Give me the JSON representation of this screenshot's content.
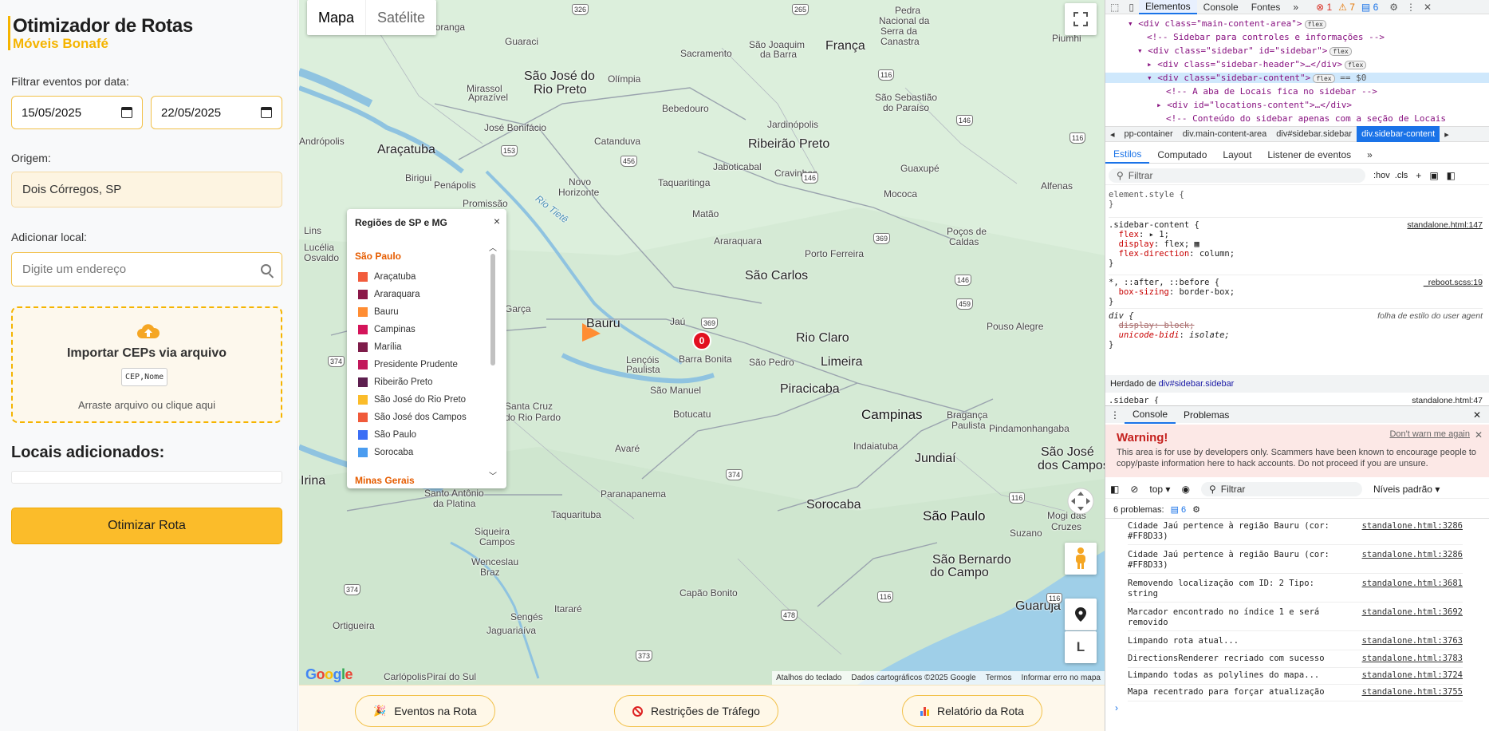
{
  "sidebar": {
    "title": "Otimizador de Rotas",
    "subtitle": "Móveis Bonafé",
    "filter_label": "Filtrar eventos por data:",
    "date_start": "15/05/2025",
    "date_end": "22/05/2025",
    "origin_label": "Origem:",
    "origin_value": "Dois Córregos, SP",
    "add_label": "Adicionar local:",
    "add_placeholder": "Digite um endereço",
    "import_title": "Importar CEPs via arquivo",
    "import_chip_a": "CEP",
    "import_chip_sep": ",",
    "import_chip_b": "Nome",
    "import_hint": "Arraste arquivo ou clique aqui",
    "locais_title": "Locais adicionados:",
    "optimize_button": "Otimizar Rota",
    "accent_color": "#fbbc2a"
  },
  "map": {
    "type_map": "Mapa",
    "type_sat": "Satélite",
    "marker_label": "0",
    "google": "Google",
    "attribution": [
      "Atalhos do teclado",
      "Dados cartográficos ©2025 Google",
      "Termos",
      "Informar erro no mapa"
    ],
    "zoom_label": "L",
    "cities": [
      {
        "n": "Votuporanga"
      },
      {
        "n": "Guaraci"
      },
      {
        "n": "França"
      },
      {
        "n": "São José do"
      },
      {
        "n": "Rio Preto"
      },
      {
        "n": "Olímpia"
      },
      {
        "n": "Mirassol"
      },
      {
        "n": "Aprazível"
      },
      {
        "n": "Bebedouro"
      },
      {
        "n": "José Bonifácio"
      },
      {
        "n": "Jardinópolis"
      },
      {
        "n": "Araçatuba"
      },
      {
        "n": "Catanduva"
      },
      {
        "n": "Ribeirão Preto"
      },
      {
        "n": "Birigui"
      },
      {
        "n": "Penápolis"
      },
      {
        "n": "Novo"
      },
      {
        "n": "Horizonte"
      },
      {
        "n": "Taquaritinga"
      },
      {
        "n": "Jaboticabal"
      },
      {
        "n": "Cravinhos"
      },
      {
        "n": "Guaxupé"
      },
      {
        "n": "Alfenas"
      },
      {
        "n": "Promissão"
      },
      {
        "n": "Matão"
      },
      {
        "n": "Mococa"
      },
      {
        "n": "Lins"
      },
      {
        "n": "Lucélia"
      },
      {
        "n": "Osvaldo"
      },
      {
        "n": "Araraquara"
      },
      {
        "n": "Porto Ferreira"
      },
      {
        "n": "Poços de"
      },
      {
        "n": "Caldas"
      },
      {
        "n": "São Carlos"
      },
      {
        "n": "Bauru"
      },
      {
        "n": "Jaú"
      },
      {
        "n": "Rio Claro"
      },
      {
        "n": "Barra Bonita"
      },
      {
        "n": "São Pedro"
      },
      {
        "n": "Limeira"
      },
      {
        "n": "Lençóis"
      },
      {
        "n": "Paulista"
      },
      {
        "n": "Pouso Alegre"
      },
      {
        "n": "São Manuel"
      },
      {
        "n": "Piracicaba"
      },
      {
        "n": "Botucatu"
      },
      {
        "n": "Campinas"
      },
      {
        "n": "Bragança"
      },
      {
        "n": "Paulista"
      },
      {
        "n": "Indaiatuba"
      },
      {
        "n": "Jundiaí"
      },
      {
        "n": "Pindamonhangaba"
      },
      {
        "n": "São José"
      },
      {
        "n": "dos Campos"
      },
      {
        "n": "Avaré"
      },
      {
        "n": "Santa Cruz"
      },
      {
        "n": "do Rio Pardo"
      },
      {
        "n": "Sorocaba"
      },
      {
        "n": "São Paulo"
      },
      {
        "n": "Mogi das"
      },
      {
        "n": "Cruzes"
      },
      {
        "n": "Suzano"
      },
      {
        "n": "São Bernardo"
      },
      {
        "n": "do Campo"
      },
      {
        "n": "Guarujá"
      },
      {
        "n": "Taquarituba"
      },
      {
        "n": "Paranapanema"
      },
      {
        "n": "Santo Antônio"
      },
      {
        "n": "da Platina"
      },
      {
        "n": "Siqueira"
      },
      {
        "n": "Campos"
      },
      {
        "n": "Wenceslau"
      },
      {
        "n": "Braz"
      },
      {
        "n": "Itararé"
      },
      {
        "n": "Capão Bonito"
      },
      {
        "n": "Jaguariaíva"
      },
      {
        "n": "Sengés"
      },
      {
        "n": "Ortigueira"
      },
      {
        "n": "Piraí do Sul"
      },
      {
        "n": "Garça"
      },
      {
        "n": "Irina"
      },
      {
        "n": "Pedra"
      },
      {
        "n": "Nacional da"
      },
      {
        "n": "Serra da"
      },
      {
        "n": "Canastra"
      },
      {
        "n": "Piumhi"
      },
      {
        "n": "São Joaquim"
      },
      {
        "n": "da Barra"
      },
      {
        "n": "Sacramento"
      },
      {
        "n": "São Sebastião"
      },
      {
        "n": "do Paraíso"
      },
      {
        "n": "Andrópolis"
      },
      {
        "n": "Rio Tietê"
      },
      {
        "n": "Carlópolis"
      }
    ],
    "shields": [
      "153",
      "153",
      "456",
      "326",
      "265",
      "369",
      "369",
      "374",
      "374",
      "374",
      "116",
      "116",
      "116",
      "459",
      "146",
      "146",
      "116",
      "146",
      "478",
      "373",
      "116"
    ]
  },
  "legend": {
    "title": "Regiões de SP e MG",
    "close": "×",
    "region1": "São Paulo",
    "region2": "Minas Gerais",
    "items": [
      {
        "label": "Araçatuba",
        "color": "#f25c3c"
      },
      {
        "label": "Araraquara",
        "color": "#8b1848"
      },
      {
        "label": "Bauru",
        "color": "#ff8d33"
      },
      {
        "label": "Campinas",
        "color": "#d4145a"
      },
      {
        "label": "Marília",
        "color": "#7e1c4a"
      },
      {
        "label": "Presidente Prudente",
        "color": "#c2185b"
      },
      {
        "label": "Ribeirão Preto",
        "color": "#5d1f4f"
      },
      {
        "label": "São José do Rio Preto",
        "color": "#fbbc2a"
      },
      {
        "label": "São José dos Campos",
        "color": "#f05a3a"
      },
      {
        "label": "São Paulo",
        "color": "#3b6ef5"
      },
      {
        "label": "Sorocaba",
        "color": "#4a9cf0"
      }
    ]
  },
  "bottom": {
    "events": "Eventos na Rota",
    "restrictions": "Restrições de Tráfego",
    "report": "Relatório da Rota"
  },
  "devtools": {
    "tabs": [
      "Elementos",
      "Console",
      "Fontes",
      "»"
    ],
    "err_count": "1",
    "warn_count": "7",
    "msg_count": "6",
    "dom": [
      {
        "t": "<div class=\"main-content-area\">",
        "b": "flex"
      },
      {
        "t": "<!-- Sidebar para controles e informações -->",
        "b": ""
      },
      {
        "t": "<div class=\"sidebar\" id=\"sidebar\">",
        "b": "flex"
      },
      {
        "t": "<div class=\"sidebar-header\">…</div>",
        "b": "flex"
      },
      {
        "t": "<div class=\"sidebar-content\">",
        "b": "flex",
        "s": "== $0"
      },
      {
        "t": "<!-- A aba de Locais fica no sidebar -->",
        "b": ""
      },
      {
        "t": "<div id=\"locations-content\">…</div>",
        "b": ""
      },
      {
        "t": "<!-- Conteúdo do sidebar apenas com a seção de Locais",
        "b": ""
      }
    ],
    "crumbs": [
      "pp-container",
      "div.main-content-area",
      "div#sidebar.sidebar",
      "div.sidebar-content"
    ],
    "subtabs": [
      "Estilos",
      "Computado",
      "Layout",
      "Listener de eventos",
      "»"
    ],
    "filter": "Filtrar",
    "hov": ":hov",
    "cls": ".cls",
    "rules": {
      "element_style": "element.style {",
      "r1_sel": ".sidebar-content {",
      "r1_src": "standalone.html:147",
      "r1_p1": "flex",
      "r1_v1": "▸ 1;",
      "r1_p2": "display",
      "r1_v2": "flex;",
      "r1_p3": "flex-direction",
      "r1_v3": "column;",
      "r2_sel": "*, ::after, ::before {",
      "r2_src": "_reboot.scss:19",
      "r2_p1": "box-sizing",
      "r2_v1": "border-box;",
      "r3_sel": "div {",
      "r3_src": "folha de estilo do user agent",
      "r3_p1": "display: block;",
      "r3_p2": "unicode-bidi",
      "r3_v2": "isolate;",
      "inherited_label": "Herdado de",
      "inherited_from": "div#sidebar.sidebar",
      "r4_sel": ".sidebar {",
      "r4_src": "standalone.html:47"
    },
    "drawer_tabs": [
      "Console",
      "Problemas"
    ],
    "warn_title": "Warning!",
    "warn_dont": "Don't warn me again",
    "warn_body": "This area is for use by developers only. Scammers have been known to encourage people to copy/paste information here to hack accounts. Do not proceed if you are unsure.",
    "context": "top",
    "cfilter": "Filtrar",
    "levels": "Níveis padrão",
    "issues_label": "6 problemas:",
    "issues_count": "6",
    "logs": [
      {
        "msg": "Cidade Jaú pertence à região Bauru (cor: #FF8D33)",
        "src": "standalone.html:3286"
      },
      {
        "msg": "Cidade Jaú pertence à região Bauru (cor: #FF8D33)",
        "src": "standalone.html:3286"
      },
      {
        "msg": "Removendo localização com ID: 2 Tipo: string",
        "src": "standalone.html:3681"
      },
      {
        "msg": "Marcador encontrado no índice 1 e será removido",
        "src": "standalone.html:3692"
      },
      {
        "msg": "Limpando rota atual...",
        "src": "standalone.html:3763"
      },
      {
        "msg": "DirectionsRenderer recriado com sucesso",
        "src": "standalone.html:3783"
      },
      {
        "msg": "Limpando todas as polylines do mapa...",
        "src": "standalone.html:3724"
      },
      {
        "msg": "Mapa recentrado para forçar atualização",
        "src": "standalone.html:3755"
      }
    ],
    "prompt": "›"
  }
}
